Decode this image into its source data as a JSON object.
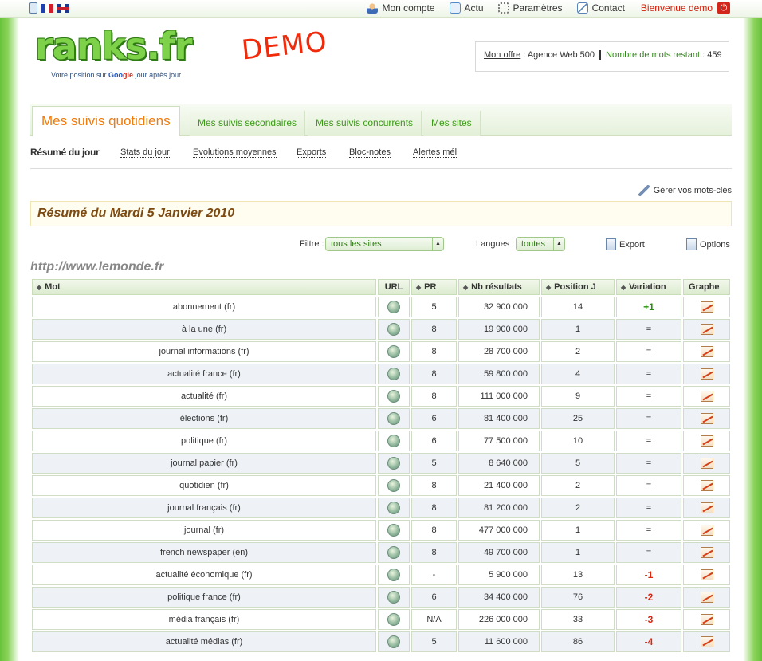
{
  "topbar": {
    "nav": [
      {
        "label": "Mon compte",
        "icon": "user-icon"
      },
      {
        "label": "Actu",
        "icon": "speech-bubble-icon"
      },
      {
        "label": "Paramètres",
        "icon": "gear-icon"
      },
      {
        "label": "Contact",
        "icon": "mail-icon"
      }
    ],
    "welcome": "Bienvenue demo"
  },
  "header": {
    "logo_text": "ranks.fr",
    "tagline_pre": "Votre position sur ",
    "tagline_google_1": "Goo",
    "tagline_google_2": "gle",
    "tagline_post": " jour après jour.",
    "demo": "DEMO",
    "offer_label": "Mon offre",
    "offer_value": " : Agence Web 500",
    "words_label": "Nombre de mots restant",
    "words_value": " : 459"
  },
  "tabs": {
    "active": "Mes suivis quotidiens",
    "items": [
      "Mes suivis secondaires",
      "Mes suivis concurrents",
      "Mes sites"
    ]
  },
  "subnav": {
    "current": "Résumé du jour",
    "items": [
      "Stats du jour",
      "Evolutions moyennes",
      "Exports",
      "Bloc-notes",
      "Alertes mél"
    ]
  },
  "actions": {
    "manage": "Gérer vos mots-clés",
    "summary_title": "Résumé du Mardi 5 Janvier 2010",
    "filter_label": "Filtre :",
    "filter_value": "tous les sites",
    "lang_label": "Langues :",
    "lang_value": "toutes",
    "export": "Export",
    "options": "Options"
  },
  "site_url": "http://www.lemonde.fr",
  "table": {
    "headers": [
      "Mot",
      "URL",
      "PR",
      "Nb résultats",
      "Position J",
      "Variation",
      "Graphe"
    ],
    "rows": [
      {
        "mot": "abonnement (fr)",
        "pr": "5",
        "nb": "32 900 000",
        "pos": "14",
        "var": "+1",
        "trend": "pos"
      },
      {
        "mot": "à la une (fr)",
        "pr": "8",
        "nb": "19 900 000",
        "pos": "1",
        "var": "=",
        "trend": "eq"
      },
      {
        "mot": "journal informations (fr)",
        "pr": "8",
        "nb": "28 700 000",
        "pos": "2",
        "var": "=",
        "trend": "eq"
      },
      {
        "mot": "actualité france (fr)",
        "pr": "8",
        "nb": "59 800 000",
        "pos": "4",
        "var": "=",
        "trend": "eq"
      },
      {
        "mot": "actualité (fr)",
        "pr": "8",
        "nb": "111 000 000",
        "pos": "9",
        "var": "=",
        "trend": "eq"
      },
      {
        "mot": "élections (fr)",
        "pr": "6",
        "nb": "81 400 000",
        "pos": "25",
        "var": "=",
        "trend": "eq"
      },
      {
        "mot": "politique (fr)",
        "pr": "6",
        "nb": "77 500 000",
        "pos": "10",
        "var": "=",
        "trend": "eq"
      },
      {
        "mot": "journal papier (fr)",
        "pr": "5",
        "nb": "8 640 000",
        "pos": "5",
        "var": "=",
        "trend": "eq"
      },
      {
        "mot": "quotidien (fr)",
        "pr": "8",
        "nb": "21 400 000",
        "pos": "2",
        "var": "=",
        "trend": "eq"
      },
      {
        "mot": "journal français (fr)",
        "pr": "8",
        "nb": "81 200 000",
        "pos": "2",
        "var": "=",
        "trend": "eq"
      },
      {
        "mot": "journal (fr)",
        "pr": "8",
        "nb": "477 000 000",
        "pos": "1",
        "var": "=",
        "trend": "eq"
      },
      {
        "mot": "french newspaper (en)",
        "pr": "8",
        "nb": "49 700 000",
        "pos": "1",
        "var": "=",
        "trend": "eq"
      },
      {
        "mot": "actualité économique (fr)",
        "pr": "-",
        "nb": "5 900 000",
        "pos": "13",
        "var": "-1",
        "trend": "neg"
      },
      {
        "mot": "politique france (fr)",
        "pr": "6",
        "nb": "34 400 000",
        "pos": "76",
        "var": "-2",
        "trend": "neg"
      },
      {
        "mot": "média français (fr)",
        "pr": "N/A",
        "nb": "226 000 000",
        "pos": "33",
        "var": "-3",
        "trend": "neg"
      },
      {
        "mot": "actualité médias (fr)",
        "pr": "5",
        "nb": "11 600 000",
        "pos": "86",
        "var": "-4",
        "trend": "neg"
      }
    ]
  },
  "colors": {
    "accent_green": "#3c9a18",
    "active_tab_orange": "#f07b0b",
    "positive": "#2a8a12",
    "negative": "#e0240c",
    "alt_row": "#eef2f7"
  }
}
